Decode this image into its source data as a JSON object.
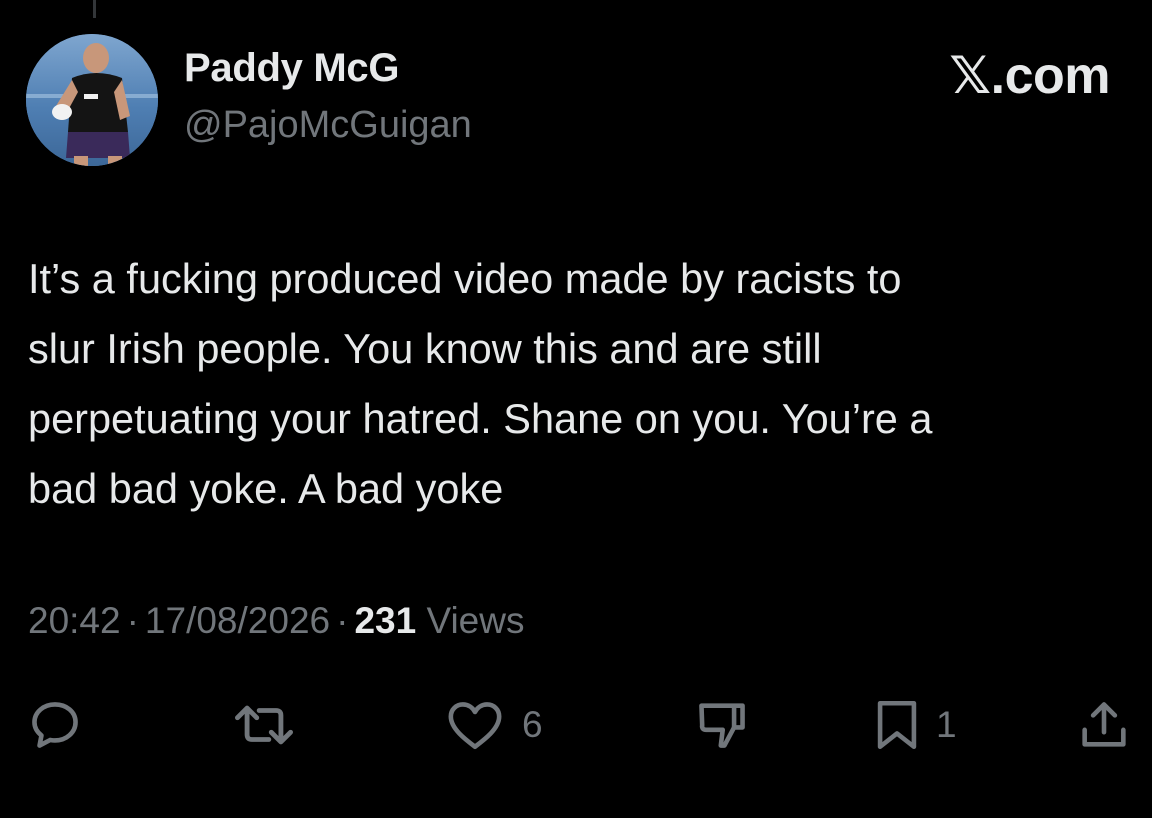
{
  "brand": "𝕏.com",
  "user": {
    "display_name": "Paddy McG",
    "handle": "@PajoMcGuigan",
    "avatar_icon": "profile-photo"
  },
  "tweet": {
    "lines": [
      "It’s a fucking produced video made by racists to",
      "slur Irish people. You know this and are still",
      "perpetuating your hatred. Shane on you. You’re a",
      "bad bad yoke. A bad yoke"
    ],
    "time": "20:42",
    "date": "17/08/2026",
    "separator": "·",
    "views_count": "231",
    "views_label": "Views"
  },
  "actions": {
    "reply_icon": "speech-bubble",
    "retweet_icon": "retweet-arrows",
    "like_icon": "heart",
    "like_count": "6",
    "dislike_icon": "thumbs-down",
    "bookmark_icon": "bookmark",
    "bookmark_count": "1",
    "share_icon": "upload-arrow"
  },
  "colors": {
    "background": "#000000",
    "primary_text": "#e7e9ea",
    "secondary_text": "#71767b"
  }
}
